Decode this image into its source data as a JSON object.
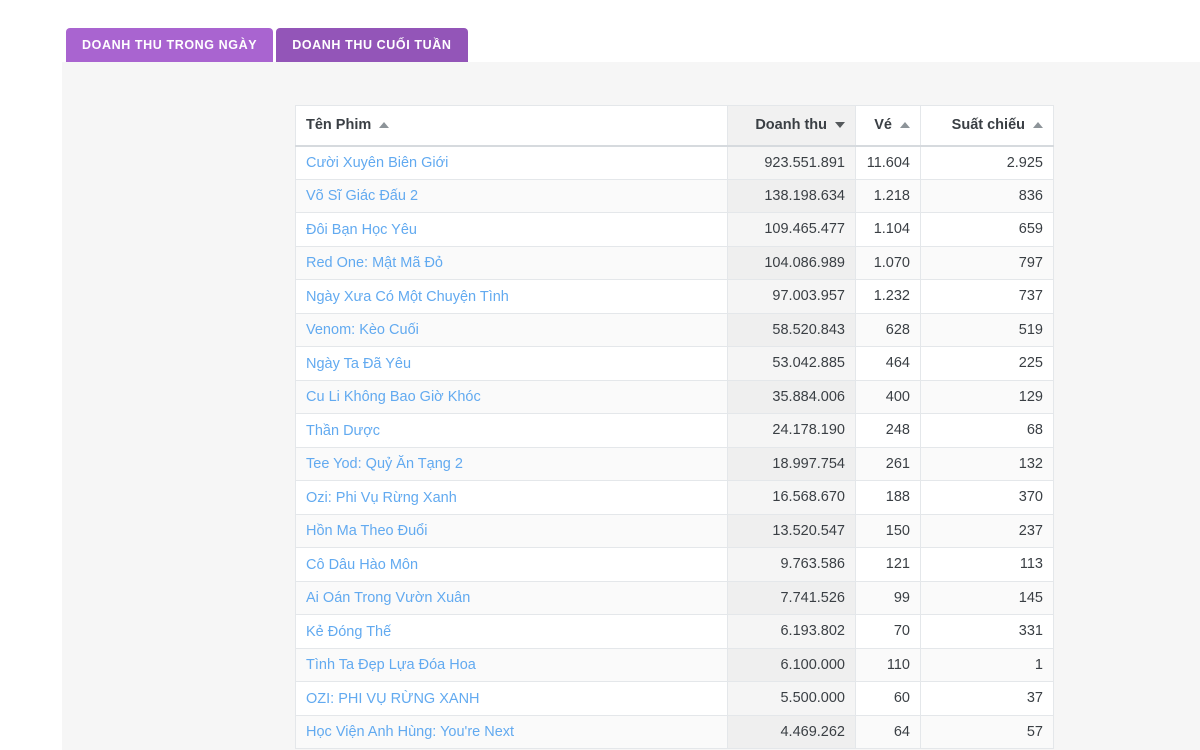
{
  "tabs": [
    {
      "label": "Doanh thu trong ngày",
      "active": false
    },
    {
      "label": "Doanh thu cuối tuần",
      "active": true
    }
  ],
  "colors": {
    "tab_inactive": "#a964d0",
    "tab_active": "#9355b8",
    "panel_background": "#f6f6f6",
    "link": "#62aaf0",
    "row_stripe": "#fafafa",
    "sorted_column": "#f1f1f1"
  },
  "table": {
    "columns": [
      {
        "key": "name",
        "label": "Tên Phim",
        "align": "left",
        "sort": "asc",
        "sorted": false
      },
      {
        "key": "rev",
        "label": "Doanh thu",
        "align": "right",
        "sort": "desc",
        "sorted": true
      },
      {
        "key": "tick",
        "label": "Vé",
        "align": "right",
        "sort": "asc",
        "sorted": false
      },
      {
        "key": "show",
        "label": "Suất chiếu",
        "align": "right",
        "sort": "asc",
        "sorted": false
      }
    ],
    "rows": [
      {
        "name": "Cười Xuyên Biên Giới",
        "rev": "923.551.891",
        "tick": "11.604",
        "show": "2.925"
      },
      {
        "name": "Võ Sĩ Giác Đấu 2",
        "rev": "138.198.634",
        "tick": "1.218",
        "show": "836"
      },
      {
        "name": "Đôi Bạn Học Yêu",
        "rev": "109.465.477",
        "tick": "1.104",
        "show": "659"
      },
      {
        "name": "Red One: Mật Mã Đỏ",
        "rev": "104.086.989",
        "tick": "1.070",
        "show": "797"
      },
      {
        "name": "Ngày Xưa Có Một Chuyện Tình",
        "rev": "97.003.957",
        "tick": "1.232",
        "show": "737"
      },
      {
        "name": "Venom: Kèo Cuối",
        "rev": "58.520.843",
        "tick": "628",
        "show": "519"
      },
      {
        "name": "Ngày Ta Đã Yêu",
        "rev": "53.042.885",
        "tick": "464",
        "show": "225"
      },
      {
        "name": "Cu Li Không Bao Giờ Khóc",
        "rev": "35.884.006",
        "tick": "400",
        "show": "129"
      },
      {
        "name": "Thần Dược",
        "rev": "24.178.190",
        "tick": "248",
        "show": "68"
      },
      {
        "name": "Tee Yod: Quỷ Ăn Tạng 2",
        "rev": "18.997.754",
        "tick": "261",
        "show": "132"
      },
      {
        "name": "Ozi: Phi Vụ Rừng Xanh",
        "rev": "16.568.670",
        "tick": "188",
        "show": "370"
      },
      {
        "name": "Hồn Ma Theo Đuổi",
        "rev": "13.520.547",
        "tick": "150",
        "show": "237"
      },
      {
        "name": "Cô Dâu Hào Môn",
        "rev": "9.763.586",
        "tick": "121",
        "show": "113"
      },
      {
        "name": "Ai Oán Trong Vườn Xuân",
        "rev": "7.741.526",
        "tick": "99",
        "show": "145"
      },
      {
        "name": "Kẻ Đóng Thế",
        "rev": "6.193.802",
        "tick": "70",
        "show": "331"
      },
      {
        "name": "Tình Ta Đẹp Lựa Đóa Hoa",
        "rev": "6.100.000",
        "tick": "110",
        "show": "1"
      },
      {
        "name": "OZI: PHI VỤ RỪNG XANH",
        "rev": "5.500.000",
        "tick": "60",
        "show": "37"
      },
      {
        "name": "Học Viện Anh Hùng: You're Next",
        "rev": "4.469.262",
        "tick": "64",
        "show": "57"
      }
    ]
  }
}
